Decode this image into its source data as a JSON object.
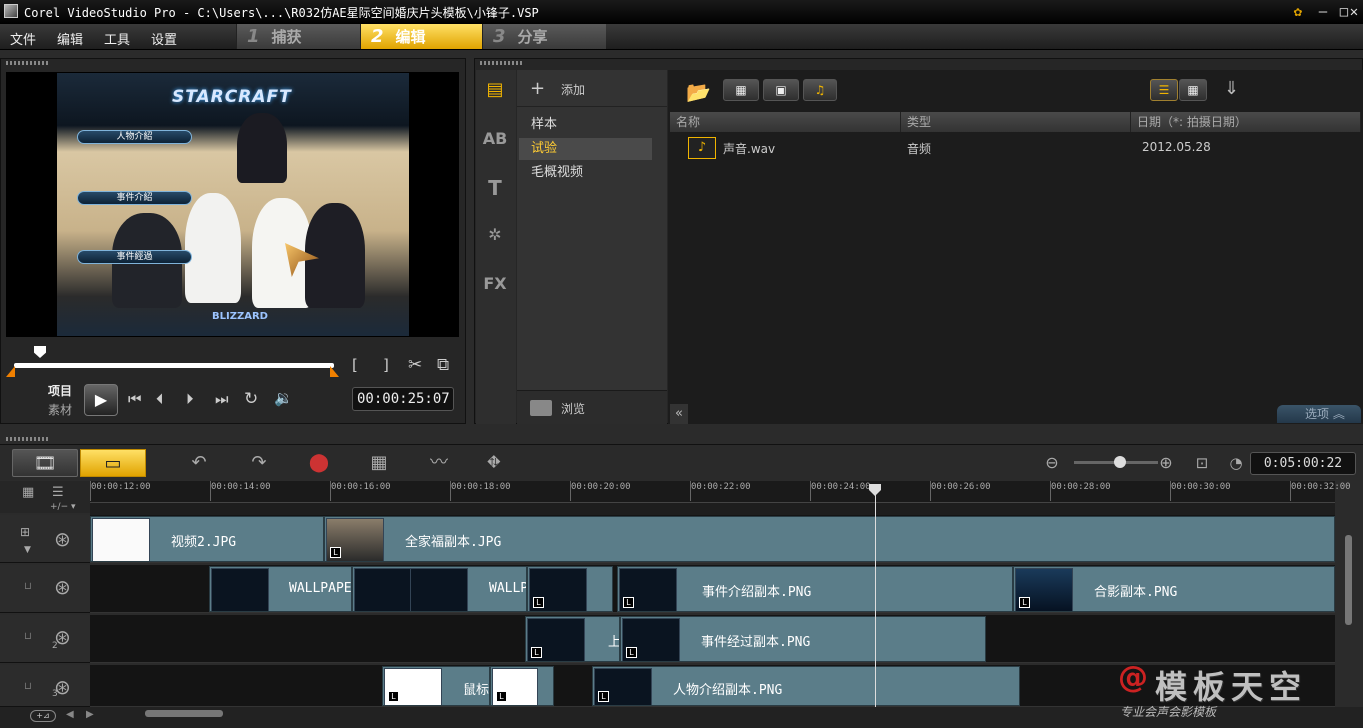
{
  "window": {
    "title": "Corel VideoStudio Pro - C:\\Users\\...\\R032仿AE星际空间婚庆片头模板\\小锋子.VSP"
  },
  "menu": [
    "文件",
    "编辑",
    "工具",
    "设置"
  ],
  "steps": [
    {
      "num": "1",
      "label": "捕获"
    },
    {
      "num": "2",
      "label": "编辑",
      "active": true
    },
    {
      "num": "3",
      "label": "分享"
    }
  ],
  "preview": {
    "logo_text": "STARCRAFT",
    "buttons": [
      "人物介紹",
      "事件介紹",
      "事件經過"
    ],
    "mode_project": "项目",
    "mode_clip": "素材",
    "timecode": "00:00:25:07"
  },
  "library": {
    "add_label": "添加",
    "folders": [
      "样本",
      "试验",
      "毛概视频"
    ],
    "selected_folder": "试验",
    "browse_label": "浏览",
    "options_label": "选项",
    "columns": [
      "名称",
      "类型",
      "日期（*: 拍摄日期）"
    ],
    "files": [
      {
        "name": "声音.wav",
        "type": "音频",
        "date": "2012.05.28"
      }
    ]
  },
  "timeline": {
    "total_duration": "0:05:00:22",
    "ruler_ticks": [
      "00:00:12:00",
      "00:00:14:00",
      "00:00:16:00",
      "00:00:18:00",
      "00:00:20:00",
      "00:00:22:00",
      "00:00:24:00",
      "00:00:26:00",
      "00:00:28:00",
      "00:00:30:00",
      "00:00:32:00"
    ],
    "overlay_numbers": [
      "2",
      "3"
    ],
    "clips": {
      "video1": "视频2.JPG",
      "video2": "全家福副本.JPG",
      "ov1a": "WALLPAPE",
      "ov1b": "WALLP",
      "ov1c": "事件介绍副本.PNG",
      "ov1d": "合影副本.PNG",
      "ov2a": "上",
      "ov2b": "事件经过副本.PNG",
      "ov3a": "鼠标",
      "ov3b": "人物介绍副本.PNG"
    }
  },
  "watermark": {
    "main": "模板天空",
    "sub": "专业会声会影模板"
  },
  "colors": {
    "accent": "#f0b400",
    "clip": "#5b7d89"
  }
}
